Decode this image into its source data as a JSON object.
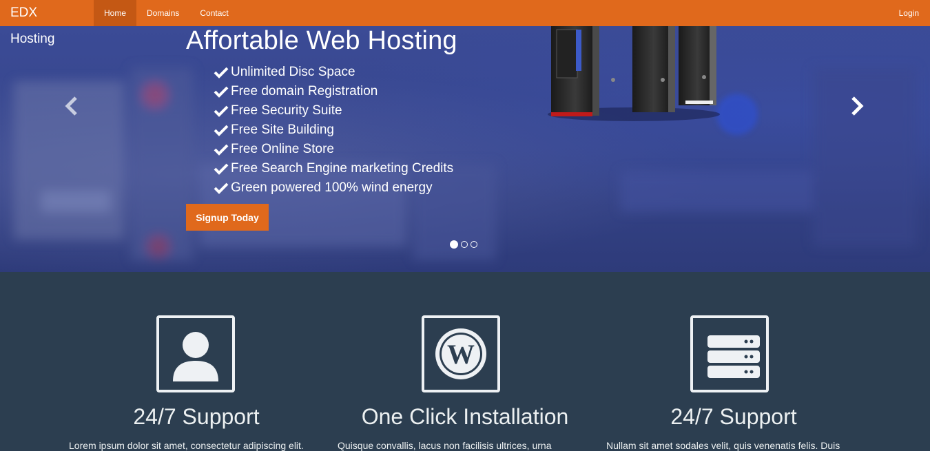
{
  "navbar": {
    "brand": "EDX Hosting",
    "items": [
      {
        "label": "Home",
        "active": true
      },
      {
        "label": "Domains",
        "active": false
      },
      {
        "label": "Contact",
        "active": false
      }
    ],
    "login": "Login",
    "color": "#e0691c"
  },
  "hero": {
    "title": "Affortable Web Hosting",
    "features": [
      "Unlimited Disc Space",
      "Free domain Registration",
      "Free Security Suite",
      "Free Site Building",
      "Free Online Store",
      "Free Search Engine marketing Credits",
      "Green powered 100% wind energy"
    ],
    "button": "Signup Today",
    "slides": 3,
    "active_slide": 1,
    "prev_icon": "chevron-left-icon",
    "next_icon": "chevron-right-icon"
  },
  "features": [
    {
      "icon": "user-icon",
      "title": "24/7 Support",
      "text": "Lorem ipsum dolor sit amet, consectetur adipiscing elit."
    },
    {
      "icon": "wordpress-icon",
      "title": "One Click Installation",
      "text": "Quisque convallis, lacus non facilisis ultrices, urna"
    },
    {
      "icon": "server-icon",
      "title": "24/7 Support",
      "text": "Nullam sit amet sodales velit, quis venenatis felis. Duis"
    }
  ]
}
